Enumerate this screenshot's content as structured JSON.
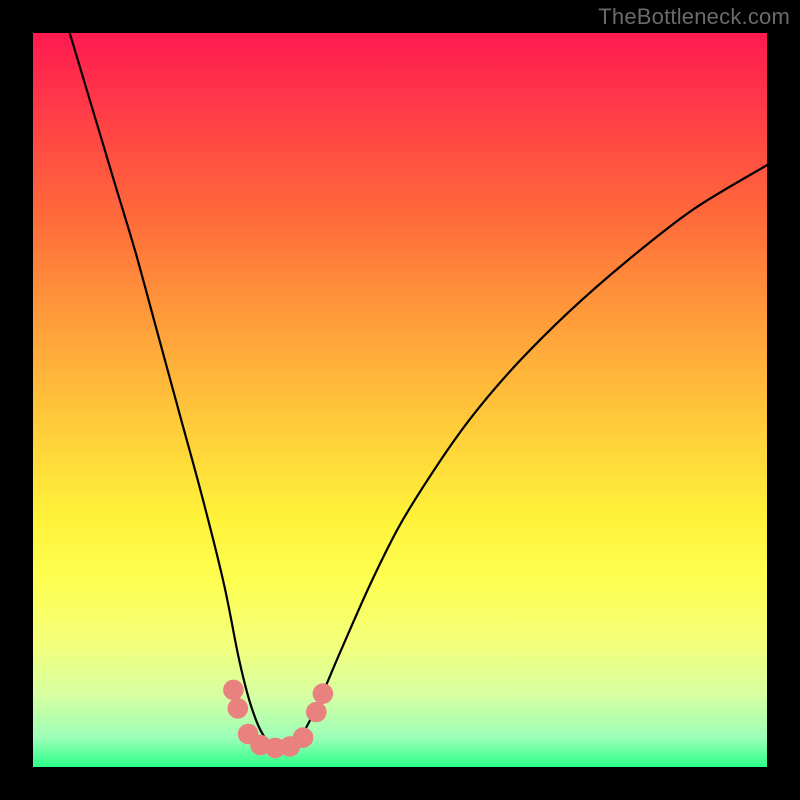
{
  "watermark": "TheBottleneck.com",
  "chart_data": {
    "type": "line",
    "title": "",
    "xlabel": "",
    "ylabel": "",
    "xlim": [
      0,
      100
    ],
    "ylim": [
      0,
      100
    ],
    "series": [
      {
        "name": "bottleneck-curve",
        "x": [
          5,
          8,
          11,
          14,
          17,
          20,
          23,
          26,
          28,
          29.5,
          31,
          32.5,
          34,
          35.5,
          37,
          39,
          42,
          46,
          50,
          55,
          60,
          66,
          73,
          81,
          90,
          100
        ],
        "y": [
          100,
          90,
          80,
          70,
          59,
          48,
          37,
          25,
          15,
          9,
          5,
          3,
          2.5,
          3,
          5,
          9,
          16,
          25,
          33,
          41,
          48,
          55,
          62,
          69,
          76,
          82
        ]
      }
    ],
    "markers": [
      {
        "x": 27.3,
        "y": 10.5,
        "r": 1.4
      },
      {
        "x": 27.9,
        "y": 8.0,
        "r": 1.4
      },
      {
        "x": 29.3,
        "y": 4.5,
        "r": 1.4
      },
      {
        "x": 31.0,
        "y": 3.0,
        "r": 1.4
      },
      {
        "x": 33.0,
        "y": 2.6,
        "r": 1.4
      },
      {
        "x": 35.0,
        "y": 2.8,
        "r": 1.4
      },
      {
        "x": 36.8,
        "y": 4.0,
        "r": 1.4
      },
      {
        "x": 38.6,
        "y": 7.5,
        "r": 1.4
      },
      {
        "x": 39.5,
        "y": 10.0,
        "r": 1.4
      }
    ],
    "marker_color": "#e9817e",
    "curve_color": "#000000",
    "curve_width": 2.2
  }
}
